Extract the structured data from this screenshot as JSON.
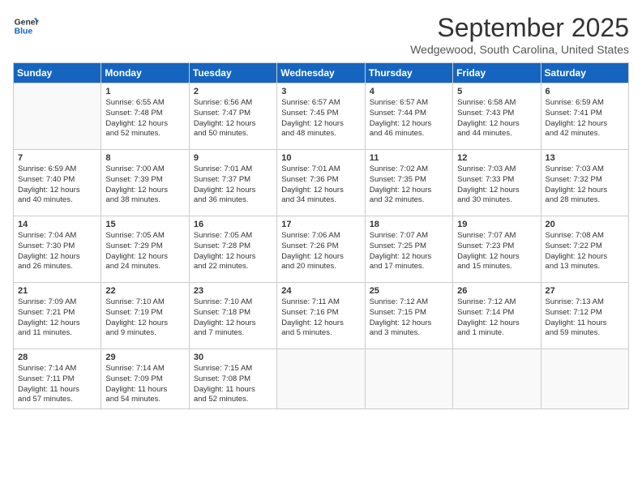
{
  "logo": {
    "line1": "General",
    "line2": "Blue"
  },
  "title": "September 2025",
  "location": "Wedgewood, South Carolina, United States",
  "days_of_week": [
    "Sunday",
    "Monday",
    "Tuesday",
    "Wednesday",
    "Thursday",
    "Friday",
    "Saturday"
  ],
  "weeks": [
    [
      {
        "num": "",
        "text": ""
      },
      {
        "num": "1",
        "text": "Sunrise: 6:55 AM\nSunset: 7:48 PM\nDaylight: 12 hours\nand 52 minutes."
      },
      {
        "num": "2",
        "text": "Sunrise: 6:56 AM\nSunset: 7:47 PM\nDaylight: 12 hours\nand 50 minutes."
      },
      {
        "num": "3",
        "text": "Sunrise: 6:57 AM\nSunset: 7:45 PM\nDaylight: 12 hours\nand 48 minutes."
      },
      {
        "num": "4",
        "text": "Sunrise: 6:57 AM\nSunset: 7:44 PM\nDaylight: 12 hours\nand 46 minutes."
      },
      {
        "num": "5",
        "text": "Sunrise: 6:58 AM\nSunset: 7:43 PM\nDaylight: 12 hours\nand 44 minutes."
      },
      {
        "num": "6",
        "text": "Sunrise: 6:59 AM\nSunset: 7:41 PM\nDaylight: 12 hours\nand 42 minutes."
      }
    ],
    [
      {
        "num": "7",
        "text": "Sunrise: 6:59 AM\nSunset: 7:40 PM\nDaylight: 12 hours\nand 40 minutes."
      },
      {
        "num": "8",
        "text": "Sunrise: 7:00 AM\nSunset: 7:39 PM\nDaylight: 12 hours\nand 38 minutes."
      },
      {
        "num": "9",
        "text": "Sunrise: 7:01 AM\nSunset: 7:37 PM\nDaylight: 12 hours\nand 36 minutes."
      },
      {
        "num": "10",
        "text": "Sunrise: 7:01 AM\nSunset: 7:36 PM\nDaylight: 12 hours\nand 34 minutes."
      },
      {
        "num": "11",
        "text": "Sunrise: 7:02 AM\nSunset: 7:35 PM\nDaylight: 12 hours\nand 32 minutes."
      },
      {
        "num": "12",
        "text": "Sunrise: 7:03 AM\nSunset: 7:33 PM\nDaylight: 12 hours\nand 30 minutes."
      },
      {
        "num": "13",
        "text": "Sunrise: 7:03 AM\nSunset: 7:32 PM\nDaylight: 12 hours\nand 28 minutes."
      }
    ],
    [
      {
        "num": "14",
        "text": "Sunrise: 7:04 AM\nSunset: 7:30 PM\nDaylight: 12 hours\nand 26 minutes."
      },
      {
        "num": "15",
        "text": "Sunrise: 7:05 AM\nSunset: 7:29 PM\nDaylight: 12 hours\nand 24 minutes."
      },
      {
        "num": "16",
        "text": "Sunrise: 7:05 AM\nSunset: 7:28 PM\nDaylight: 12 hours\nand 22 minutes."
      },
      {
        "num": "17",
        "text": "Sunrise: 7:06 AM\nSunset: 7:26 PM\nDaylight: 12 hours\nand 20 minutes."
      },
      {
        "num": "18",
        "text": "Sunrise: 7:07 AM\nSunset: 7:25 PM\nDaylight: 12 hours\nand 17 minutes."
      },
      {
        "num": "19",
        "text": "Sunrise: 7:07 AM\nSunset: 7:23 PM\nDaylight: 12 hours\nand 15 minutes."
      },
      {
        "num": "20",
        "text": "Sunrise: 7:08 AM\nSunset: 7:22 PM\nDaylight: 12 hours\nand 13 minutes."
      }
    ],
    [
      {
        "num": "21",
        "text": "Sunrise: 7:09 AM\nSunset: 7:21 PM\nDaylight: 12 hours\nand 11 minutes."
      },
      {
        "num": "22",
        "text": "Sunrise: 7:10 AM\nSunset: 7:19 PM\nDaylight: 12 hours\nand 9 minutes."
      },
      {
        "num": "23",
        "text": "Sunrise: 7:10 AM\nSunset: 7:18 PM\nDaylight: 12 hours\nand 7 minutes."
      },
      {
        "num": "24",
        "text": "Sunrise: 7:11 AM\nSunset: 7:16 PM\nDaylight: 12 hours\nand 5 minutes."
      },
      {
        "num": "25",
        "text": "Sunrise: 7:12 AM\nSunset: 7:15 PM\nDaylight: 12 hours\nand 3 minutes."
      },
      {
        "num": "26",
        "text": "Sunrise: 7:12 AM\nSunset: 7:14 PM\nDaylight: 12 hours\nand 1 minute."
      },
      {
        "num": "27",
        "text": "Sunrise: 7:13 AM\nSunset: 7:12 PM\nDaylight: 11 hours\nand 59 minutes."
      }
    ],
    [
      {
        "num": "28",
        "text": "Sunrise: 7:14 AM\nSunset: 7:11 PM\nDaylight: 11 hours\nand 57 minutes."
      },
      {
        "num": "29",
        "text": "Sunrise: 7:14 AM\nSunset: 7:09 PM\nDaylight: 11 hours\nand 54 minutes."
      },
      {
        "num": "30",
        "text": "Sunrise: 7:15 AM\nSunset: 7:08 PM\nDaylight: 11 hours\nand 52 minutes."
      },
      {
        "num": "",
        "text": ""
      },
      {
        "num": "",
        "text": ""
      },
      {
        "num": "",
        "text": ""
      },
      {
        "num": "",
        "text": ""
      }
    ]
  ]
}
